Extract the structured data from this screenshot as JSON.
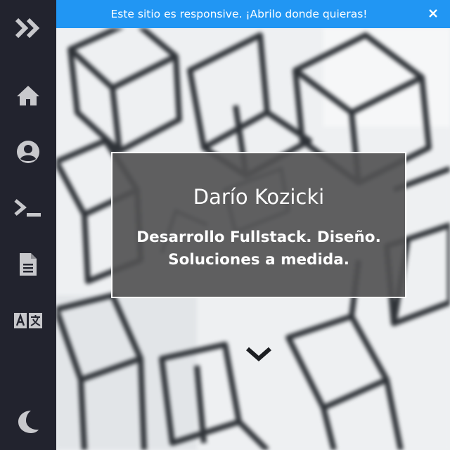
{
  "banner": {
    "text": "Este sitio es responsive. ¡Abrilo donde quieras!",
    "close_icon": "close-icon",
    "color": "#2196f3"
  },
  "sidebar": {
    "background": "#22232e",
    "icon_color": "#c8c8cc",
    "items": [
      {
        "icon": "double-chevron-right-icon"
      },
      {
        "icon": "home-icon"
      },
      {
        "icon": "user-circle-icon"
      },
      {
        "icon": "terminal-icon"
      },
      {
        "icon": "document-icon"
      },
      {
        "icon": "translate-icon"
      },
      {
        "icon": "moon-icon"
      }
    ]
  },
  "hero": {
    "name": "Darío Kozicki",
    "tagline": "Desarrollo Fullstack. Diseño. Soluciones a medida.",
    "scroll_icon": "chevron-down-icon"
  }
}
